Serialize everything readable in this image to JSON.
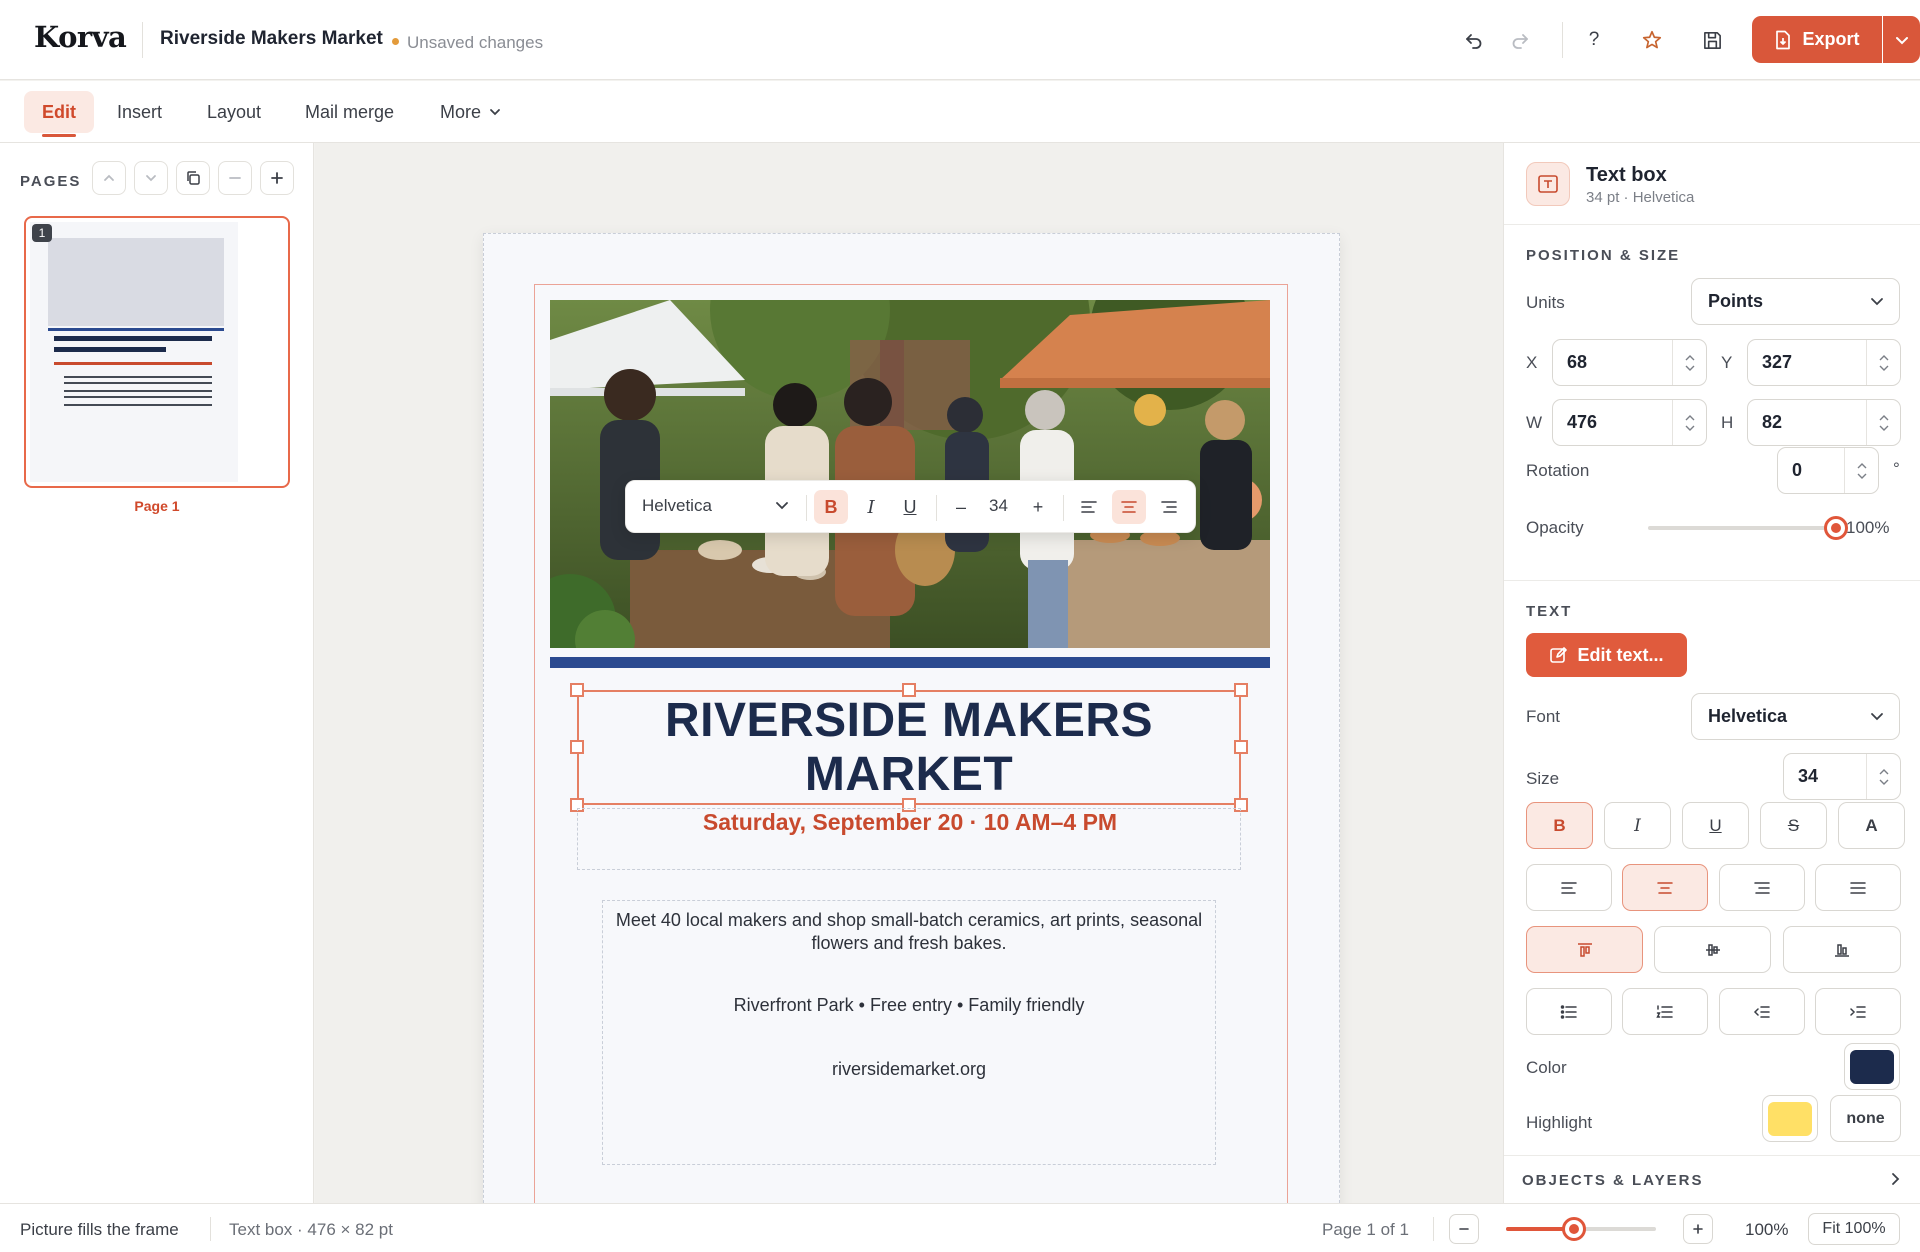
{
  "app": {
    "logo": "Korva",
    "document_title": "Riverside Makers Market",
    "status": "Unsaved changes"
  },
  "toolbar": {
    "export_label": "Export",
    "help_label": "?"
  },
  "menu": {
    "items": [
      "Edit",
      "Insert",
      "Layout",
      "Mail merge",
      "More"
    ],
    "active": "Edit"
  },
  "pages": {
    "label": "PAGES",
    "thumb_number": "1",
    "thumb_label": "Page 1"
  },
  "document": {
    "headline": "RIVERSIDE MAKERS MARKET",
    "date_line": "Saturday, September 20 · 10 AM–4 PM",
    "body_p1": "Meet 40 local makers and shop small-batch ceramics, art prints, seasonal flowers and fresh bakes.",
    "body_p2": "Riverfront Park • Free entry • Family friendly",
    "body_p3": "riversidemarket.org"
  },
  "format_bar": {
    "font": "Helvetica",
    "bold": "B",
    "italic": "I",
    "underline": "U",
    "minus": "–",
    "size": "34",
    "plus": "+"
  },
  "inspector": {
    "title": "Text box",
    "subtitle": "34 pt · Helvetica",
    "position_size_title": "POSITION & SIZE",
    "units_label": "Units",
    "units_value": "Points",
    "x_label": "X",
    "x_value": "68",
    "y_label": "Y",
    "y_value": "327",
    "w_label": "W",
    "w_value": "476",
    "h_label": "H",
    "h_value": "82",
    "rotation_label": "Rotation",
    "rotation_value": "0",
    "rotation_unit": "°",
    "opacity_label": "Opacity",
    "opacity_value": "100%",
    "opacity_fraction": 1.0,
    "text_title": "TEXT",
    "edit_text_label": "Edit text...",
    "font_label": "Font",
    "font_value": "Helvetica",
    "size_label": "Size",
    "size_value": "34",
    "style_buttons": [
      "B",
      "I",
      "U",
      "S",
      "A"
    ],
    "color_label": "Color",
    "color_value": "#1c2b4c",
    "highlight_label": "Highlight",
    "highlight_value": "#ffe066",
    "highlight_none": "none",
    "layers_title": "OBJECTS & LAYERS"
  },
  "statusbar": {
    "hint": "Picture fills the frame",
    "selection": "Text box · 476 × 82 pt",
    "page_count": "Page 1 of 1",
    "zoom": "100%",
    "fit": "Fit 100%",
    "zoom_slider_fraction": 0.45
  },
  "colors": {
    "accent": "#d9573a",
    "navy": "#1c2b4c",
    "date_red": "#c84a2e",
    "brand_blue": "#2b4a90"
  }
}
